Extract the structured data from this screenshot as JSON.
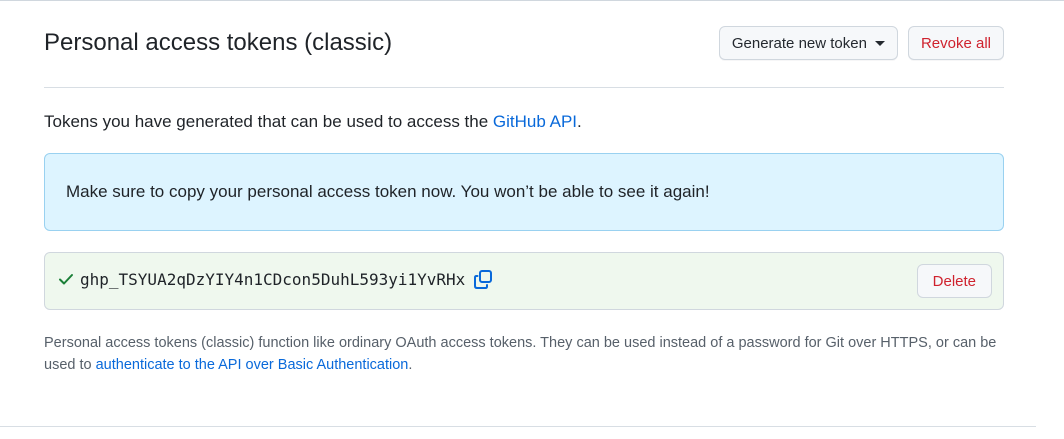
{
  "header": {
    "title": "Personal access tokens (classic)",
    "generate_label": "Generate new token",
    "revoke_label": "Revoke all"
  },
  "intro": {
    "text": "Tokens you have generated that can be used to access the ",
    "link": "GitHub API",
    "suffix": "."
  },
  "flash": {
    "message": "Make sure to copy your personal access token now. You won’t be able to see it again!"
  },
  "token": {
    "value": "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",
    "delete_label": "Delete",
    "status_icon": "check-icon",
    "copy_icon": "copy-icon"
  },
  "note": {
    "text": "Personal access tokens (classic) function like ordinary OAuth access tokens. They can be used instead of a password for Git over HTTPS, or can be used to ",
    "link": "authenticate to the API over Basic Authentication",
    "suffix": "."
  },
  "colors": {
    "link": "#0969da",
    "danger": "#cf222e",
    "flash_bg": "#ddf4ff",
    "flash_border": "#99d1f0",
    "success_bg": "#eff8ee",
    "success_icon": "#1a7f37"
  }
}
